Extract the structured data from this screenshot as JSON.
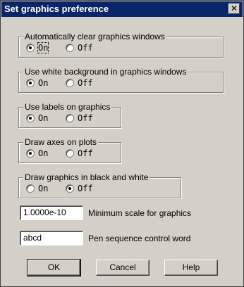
{
  "window": {
    "title": "Set graphics preference",
    "close_glyph": "✕"
  },
  "groups": [
    {
      "label": "Automatically clear graphics windows",
      "on_label": "On",
      "off_label": "Off",
      "selected": "On"
    },
    {
      "label": "Use white background in graphics windows",
      "on_label": "On",
      "off_label": "Off",
      "selected": "On"
    },
    {
      "label": "Use labels on graphics",
      "on_label": "On",
      "off_label": "Off",
      "selected": "On"
    },
    {
      "label": "Draw axes on plots",
      "on_label": "On",
      "off_label": "Off",
      "selected": "On"
    },
    {
      "label": "Draw graphics in black and white",
      "on_label": "On",
      "off_label": "Off",
      "selected": "Off"
    }
  ],
  "fields": [
    {
      "value": "1.0000e-10",
      "label": "Minimum scale for graphics"
    },
    {
      "value": "abcd",
      "label": "Pen sequence control word"
    }
  ],
  "buttons": {
    "ok": "OK",
    "cancel": "Cancel",
    "help": "Help"
  }
}
